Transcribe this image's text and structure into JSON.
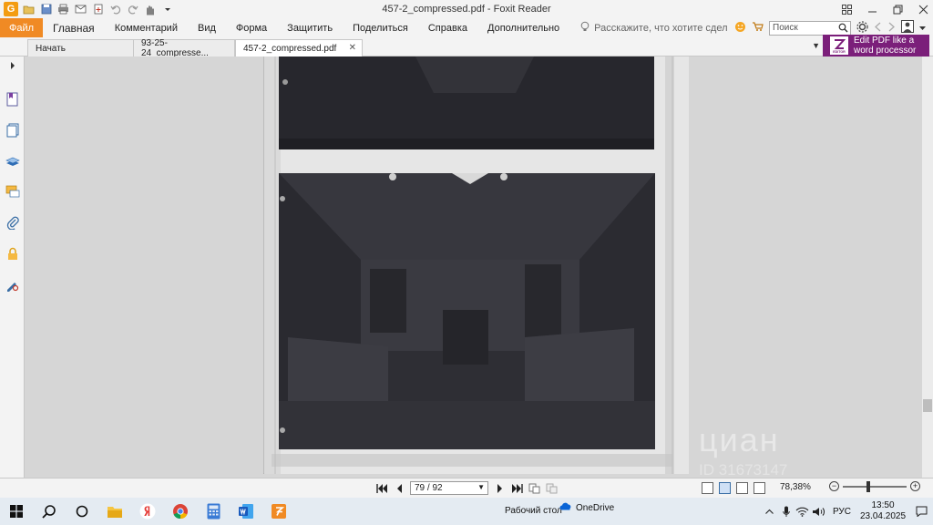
{
  "window": {
    "title": "457-2_compressed.pdf - Foxit Reader"
  },
  "ribbon": {
    "file_tab": "Файл",
    "tabs": [
      "Главная",
      "Комментарий",
      "Вид",
      "Форма",
      "Защитить",
      "Поделиться",
      "Справка",
      "Дополнительно"
    ],
    "tell_me": "Расскажите, что хотите сдел",
    "search_placeholder": "Поиск"
  },
  "doc_tabs": {
    "start": "Начать",
    "tab1": "93-25-24_compresse...",
    "tab2": "457-2_compressed.pdf",
    "promo_line1": "Edit PDF like a",
    "promo_line2": "word processor",
    "promo_logo_caption": "EDITOR"
  },
  "navigation": {
    "page_value": "79 / 92",
    "zoom": "78,38%"
  },
  "watermark": {
    "logo_text": "циан",
    "id_text": "ID 31673147"
  },
  "taskbar": {
    "desktop_label": "Рабочий стол",
    "onedrive_label": "OneDrive",
    "language": "РУС",
    "time": "13:50",
    "date": "23.04.2025"
  },
  "colors": {
    "accent_orange": "#f08a24",
    "promo_purple": "#7b1f7a",
    "photo_dark": "#2f2f35"
  },
  "zoom_level_fraction": 0.4
}
